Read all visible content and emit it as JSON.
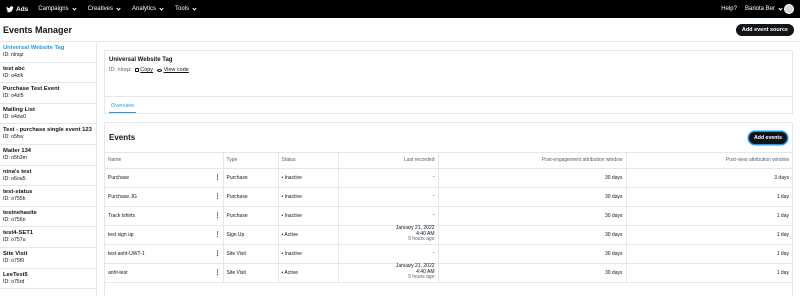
{
  "nav": {
    "brand": "Ads",
    "items": [
      "Campaigns",
      "Creatives",
      "Analytics",
      "Tools"
    ],
    "help": "Help?",
    "account": "Bariota Ber"
  },
  "header": {
    "title": "Events Manager",
    "add_source": "Add event source"
  },
  "sidebar": {
    "items": [
      {
        "name": "Universal Website Tag",
        "id": "ID: nlnqz"
      },
      {
        "name": "test abc",
        "id": "ID: o4zlk"
      },
      {
        "name": "Purchase Test Event",
        "id": "ID: o4zl5"
      },
      {
        "name": "Mailing List",
        "id": "ID: o4zw0"
      },
      {
        "name": "Test - purchase single event 123",
        "id": "ID: o5fsv"
      },
      {
        "name": "Mailer 134",
        "id": "ID: o5h3m"
      },
      {
        "name": "nina's test",
        "id": "ID: o6oa5"
      },
      {
        "name": "test-status",
        "id": "ID: o755h"
      },
      {
        "name": "testnehasite",
        "id": "ID: o756n"
      },
      {
        "name": "test4-SET1",
        "id": "ID: o757u"
      },
      {
        "name": "Site Visit",
        "id": "ID: o75f9"
      },
      {
        "name": "LeeTest5",
        "id": "ID: o75rd"
      }
    ]
  },
  "source": {
    "title": "Universal Website Tag",
    "id": "ID: nlnqz",
    "copy": "Copy",
    "view_code": "View code",
    "tab": "Overview"
  },
  "events": {
    "title": "Events",
    "add": "Add events",
    "columns": {
      "name": "Name",
      "type": "Type",
      "status": "Status",
      "last": "Last recorded",
      "eng": "Post-engagement attribution window",
      "view": "Post-view attribution window"
    },
    "rows": [
      {
        "name": "Purchase",
        "type": "Purchase",
        "status": "• Inactive",
        "last1": "-",
        "last2": "",
        "last3": "",
        "eng": "30 days",
        "view": "3 days"
      },
      {
        "name": "Purchase JG",
        "type": "Purchase",
        "status": "• Inactive",
        "last1": "-",
        "last2": "",
        "last3": "",
        "eng": "30 days",
        "view": "1 day"
      },
      {
        "name": "Track tshirts",
        "type": "Purchase",
        "status": "• Inactive",
        "last1": "-",
        "last2": "",
        "last3": "",
        "eng": "30 days",
        "view": "1 day"
      },
      {
        "name": "test sign up",
        "type": "Sign Up",
        "status": "• Active",
        "last1": "January 21, 2022",
        "last2": "4:40 AM",
        "last3": "9 hours ago",
        "eng": "30 days",
        "view": "1 day"
      },
      {
        "name": "test-anht-UWT-1",
        "type": "Site Visit",
        "status": "• Inactive",
        "last1": "-",
        "last2": "",
        "last3": "",
        "eng": "30 days",
        "view": "1 day"
      },
      {
        "name": "anht-test",
        "type": "Site Visit",
        "status": "• Active",
        "last1": "January 21, 2022",
        "last2": "4:40 AM",
        "last3": "9 hours ago",
        "eng": "30 days",
        "view": "1 day"
      }
    ]
  }
}
